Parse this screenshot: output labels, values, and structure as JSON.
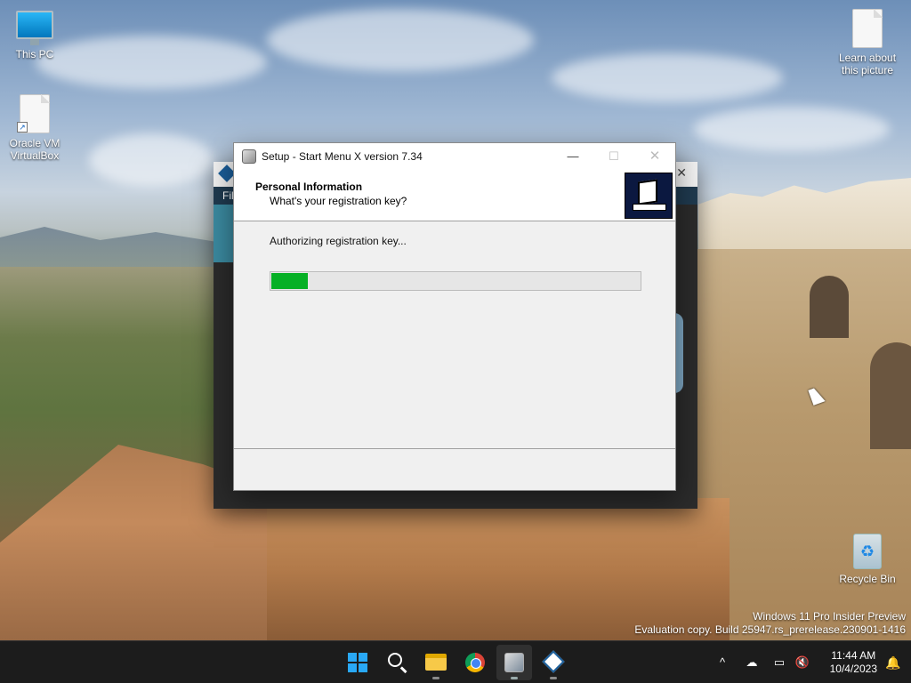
{
  "desktop": {
    "icons": [
      {
        "label": "This PC",
        "icon": "monitor-icon"
      },
      {
        "label": "Oracle VM\nVirtualBox",
        "icon": "document-icon"
      },
      {
        "label": "Learn about\nthis picture",
        "icon": "document-icon"
      },
      {
        "label": "Recycle Bin",
        "icon": "recycle-bin-icon"
      }
    ],
    "watermark": {
      "line1": "Windows 11 Pro Insider Preview",
      "line2": "Evaluation copy. Build 25947.rs_prerelease.230901-1416"
    }
  },
  "background_window": {
    "menu_label": "File"
  },
  "dialog": {
    "title": "Setup - Start Menu X version 7.34",
    "header_title": "Personal Information",
    "header_subtitle": "What's your registration key?",
    "status": "Authorizing registration key...",
    "progress_fraction": 0.1,
    "progress_color": "#06b025",
    "minimize": "—",
    "maximize": "☐",
    "close": "✕"
  },
  "taskbar": {
    "items": [
      "start-icon",
      "search-icon",
      "file-explorer-icon",
      "chrome-icon",
      "setup-icon",
      "virtualbox-icon"
    ],
    "active_item": "setup-icon",
    "tray_chevron": "^",
    "time": "11:44 AM",
    "date": "10/4/2023"
  }
}
